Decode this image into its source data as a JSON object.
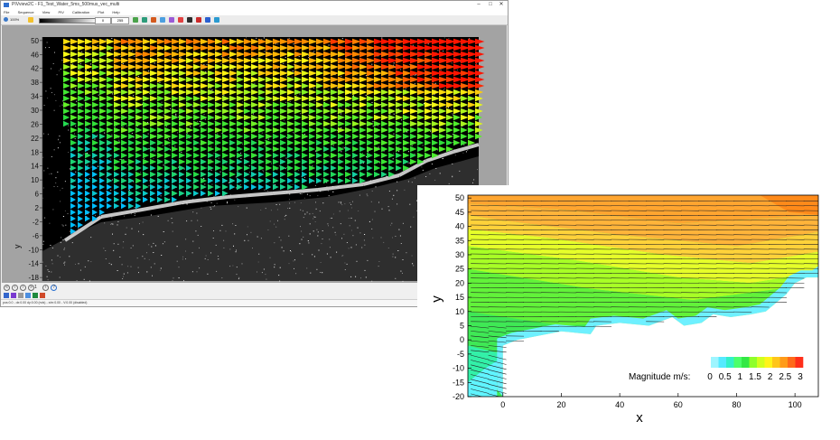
{
  "window": {
    "title": "PIVview2C - F1_Test_Water_5ms_500mus_vec_multi",
    "controls": [
      "–",
      "□",
      "✕"
    ]
  },
  "menu": [
    "File",
    "Sequence",
    "View",
    "PIV",
    "Calibration",
    "Plot",
    "Help"
  ],
  "toolbar": {
    "zoom": "100%",
    "low_value": "0",
    "high_value": "255"
  },
  "navigation": {
    "frame_text": "1"
  },
  "status_text": "pos:0.0 - dx:0.00  dy:0.00 (m/s) - x/m:0.00 - V:0.00 (disabled)",
  "icons": {
    "zoom": "zoom-icon",
    "first": "first-frame-icon",
    "prev": "prev-frame-icon",
    "next": "next-frame-icon",
    "last": "last-frame-icon"
  },
  "colors": {
    "plot_frame_bg": "#a3a3a3",
    "image_bg": "#000000",
    "colormap": [
      "#00e0ff",
      "#27ff2a",
      "#00d21a",
      "#ffff00",
      "#ff8f00",
      "#ff1a00"
    ]
  },
  "chart_data": [
    {
      "type": "vector_field",
      "ylabel": "y",
      "xlabel": "",
      "ylim": [
        -19,
        51
      ],
      "yticks": [
        50,
        46,
        42,
        38,
        34,
        30,
        26,
        22,
        18,
        14,
        10,
        6,
        2,
        -2,
        -6,
        -10,
        -14,
        -18
      ],
      "background": "particle image (grayscale)",
      "vector_colormap": "rainbow (blue-green-yellow-red)",
      "grid": false
    },
    {
      "type": "contour_vector_field",
      "xlabel": "x",
      "ylabel": "y",
      "xlim": [
        -12,
        108
      ],
      "ylim": [
        -20,
        51
      ],
      "xticks": [
        0,
        20,
        40,
        60,
        80,
        100
      ],
      "yticks": [
        50,
        45,
        40,
        35,
        30,
        25,
        20,
        15,
        10,
        5,
        0,
        -5,
        -10,
        -15,
        -20
      ],
      "colorbar": {
        "label": "Magnitude m/s:",
        "ticks": [
          "0",
          "0.5",
          "1",
          "1.5",
          "2",
          "2.5",
          "3"
        ],
        "range": [
          0,
          3
        ],
        "colors": [
          "#9ef5ff",
          "#55eaff",
          "#33f0c8",
          "#4cff6a",
          "#33e845",
          "#8fff2b",
          "#d2ff1e",
          "#fff41a",
          "#ffc61a",
          "#ff9b1a",
          "#ff6a1a",
          "#ff2f1a"
        ]
      },
      "grid": false,
      "legend": "bottom-right"
    }
  ]
}
